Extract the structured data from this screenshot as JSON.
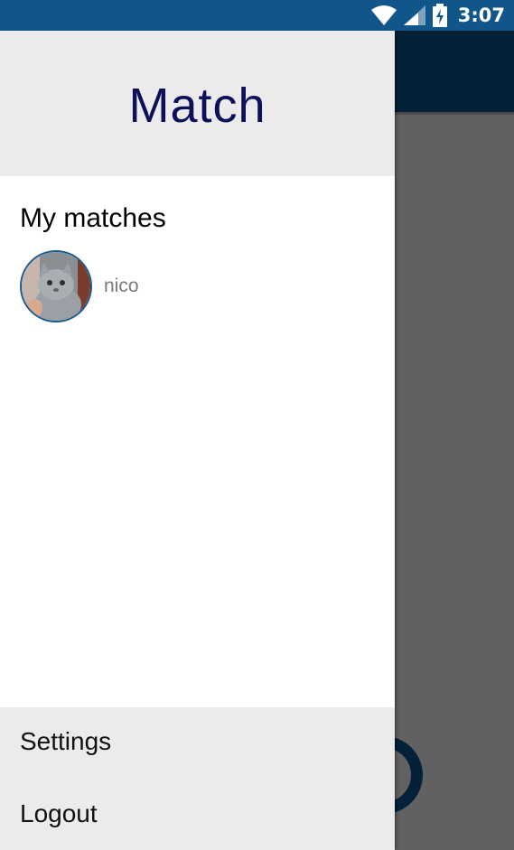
{
  "status_bar": {
    "time": "3:07",
    "icons": [
      "wifi-icon",
      "cell-signal-icon",
      "battery-charging-icon"
    ],
    "background_color": "#11568a"
  },
  "drawer": {
    "logo": "Match",
    "section_title": "My matches",
    "matches": [
      {
        "name": "nico",
        "avatar": "cat-photo"
      }
    ],
    "footer": {
      "settings_label": "Settings",
      "logout_label": "Logout"
    }
  },
  "colors": {
    "accent": "#052039",
    "logo": "#0b1058",
    "drawer_section_bg": "#ebebeb",
    "scrim": "#616161"
  }
}
